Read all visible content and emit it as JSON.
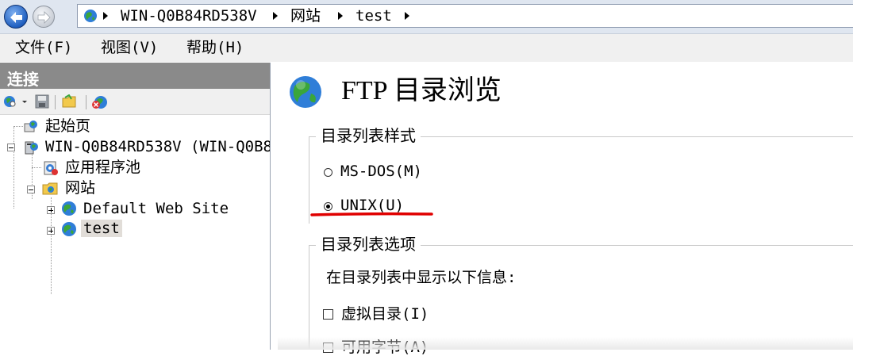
{
  "address_bar": {
    "crumbs": [
      "WIN-Q0B84RD538V",
      "网站",
      "test"
    ]
  },
  "menu": {
    "items": [
      "文件(F)",
      "视图(V)",
      "帮助(H)"
    ]
  },
  "connections": {
    "title": "连接",
    "tree": {
      "start_page": "起始页",
      "server": "WIN-Q0B84RD538V (WIN-Q0B8",
      "app_pools": "应用程序池",
      "sites": "网站",
      "site_default": "Default Web Site",
      "site_test": "test"
    }
  },
  "main": {
    "title": "FTP 目录浏览",
    "format_group": {
      "title": "目录列表样式",
      "options": [
        "MS-DOS(M)",
        "UNIX(U)"
      ],
      "selected": "UNIX(U)"
    },
    "options_group": {
      "title": "目录列表选项",
      "description": "在目录列表中显示以下信息:",
      "checkboxes": [
        "虚拟目录(I)",
        "可用字节(A)"
      ]
    }
  },
  "colors": {
    "annotation_underline": "#e00000",
    "panel_header": "#8a8a8a",
    "menu_background": "#f0f0f0"
  },
  "icons": [
    "back-arrow-icon",
    "forward-arrow-icon",
    "globe-icon",
    "connect-icon",
    "save-icon",
    "folder-icon",
    "disconnect-icon",
    "server-icon",
    "app-pool-icon",
    "sites-folder-icon"
  ]
}
